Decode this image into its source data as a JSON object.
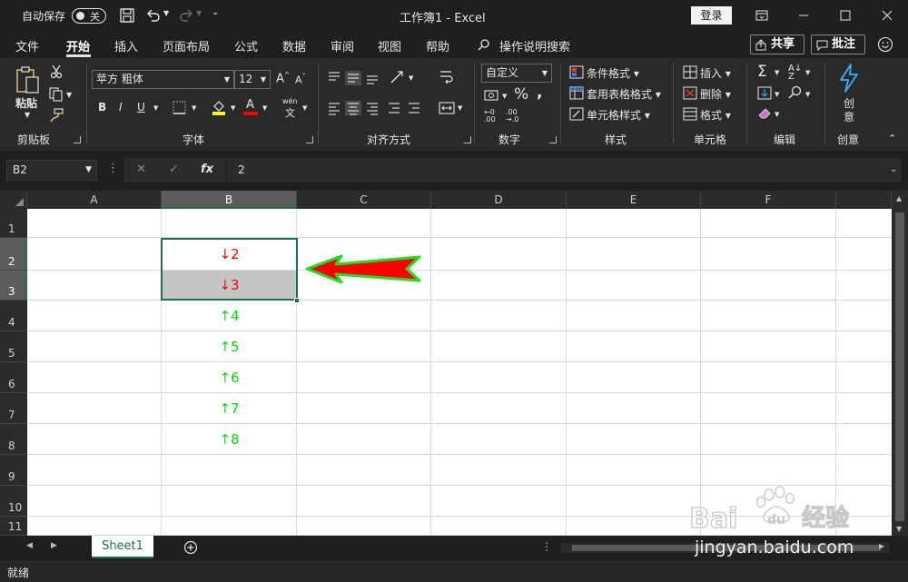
{
  "titlebar": {
    "autosave_label": "自动保存",
    "autosave_state": "关",
    "doc_title": "工作簿1  -  Excel",
    "login_label": "登录"
  },
  "menu": {
    "tabs": [
      "文件",
      "开始",
      "插入",
      "页面布局",
      "公式",
      "数据",
      "审阅",
      "视图",
      "帮助"
    ],
    "active_tab": "开始",
    "search_label": "操作说明搜索",
    "share_label": "共享",
    "comment_label": "批注"
  },
  "ribbon": {
    "clipboard": {
      "paste_label": "粘贴",
      "group_label": "剪贴板"
    },
    "font": {
      "font_name": "苹方 粗体",
      "font_size": "12",
      "grow_label": "A",
      "shrink_label": "A",
      "bold": "B",
      "italic": "I",
      "underline": "U",
      "font_color_glyph": "A",
      "phonetic_label": "wén",
      "phonetic_sub": "文",
      "group_label": "字体"
    },
    "alignment": {
      "group_label": "对齐方式"
    },
    "number": {
      "format": "自定义",
      "group_label": "数字"
    },
    "styles": {
      "conditional": "条件格式",
      "table": "套用表格格式",
      "cell_styles": "单元格样式",
      "group_label": "样式"
    },
    "cells": {
      "insert": "插入",
      "delete": "删除",
      "format": "格式",
      "group_label": "单元格"
    },
    "editing": {
      "group_label": "编辑"
    },
    "creativity": {
      "button_line1": "创",
      "button_line2": "意",
      "group_label": "创意"
    }
  },
  "formula_bar": {
    "name_box": "B2",
    "cancel_glyph": "✕",
    "enter_glyph": "✓",
    "fx_glyph": "fx",
    "formula": "2"
  },
  "grid": {
    "columns": [
      "A",
      "B",
      "C",
      "D",
      "E",
      "F"
    ],
    "rows": [
      "1",
      "2",
      "3",
      "4",
      "5",
      "6",
      "7",
      "8",
      "9",
      "10",
      "11"
    ],
    "cells_b": [
      {
        "row": "2",
        "text": "↓2",
        "color": "#ff0000"
      },
      {
        "row": "3",
        "text": "↓3",
        "color": "#ff0000"
      },
      {
        "row": "4",
        "text": "↑4",
        "color": "#00dd00"
      },
      {
        "row": "5",
        "text": "↑5",
        "color": "#00dd00"
      },
      {
        "row": "6",
        "text": "↑6",
        "color": "#00dd00"
      },
      {
        "row": "7",
        "text": "↑7",
        "color": "#00dd00"
      },
      {
        "row": "8",
        "text": "↑8",
        "color": "#00dd00"
      }
    ],
    "selection_color": "#1e7145"
  },
  "sheets": {
    "tabs": [
      "Sheet1"
    ]
  },
  "status": {
    "text": "就绪"
  },
  "watermark": {
    "logo": "Bai du 经验",
    "url": "jingyan.baidu.com"
  },
  "colors": {
    "accent": "#1e7145",
    "down_red": "#ff0000",
    "up_green": "#00dd00",
    "annotation_arrow_fill": "#ff0000",
    "annotation_arrow_stroke": "#22dd22"
  }
}
